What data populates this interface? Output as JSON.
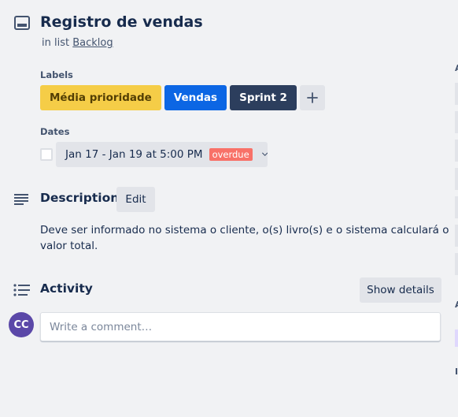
{
  "card": {
    "title": "Registro de vendas",
    "in_list_prefix": "in list",
    "list_name": "Backlog"
  },
  "labels": {
    "heading": "Labels",
    "items": [
      {
        "text": "Média prioridade",
        "bg": "#f5cd47",
        "fg": "#533f04"
      },
      {
        "text": "Vendas",
        "bg": "#0c66e4",
        "fg": "#ffffff"
      },
      {
        "text": "Sprint 2",
        "bg": "#2c3e5d",
        "fg": "#ffffff"
      }
    ],
    "add_icon": "plus-icon"
  },
  "dates": {
    "heading": "Dates",
    "range": "Jan 17 - Jan 19 at 5:00 PM",
    "status": "overdue",
    "status_color": "#f87168",
    "completed": false
  },
  "description": {
    "heading": "Description",
    "edit_label": "Edit",
    "text": "Deve ser informado no sistema o cliente, o(s) livro(s) e o sistema calculará o valor total."
  },
  "activity": {
    "heading": "Activity",
    "details_label": "Show details",
    "avatar_initials": "CC",
    "avatar_color": "#5b48a8",
    "comment_placeholder": "Write a comment…"
  }
}
